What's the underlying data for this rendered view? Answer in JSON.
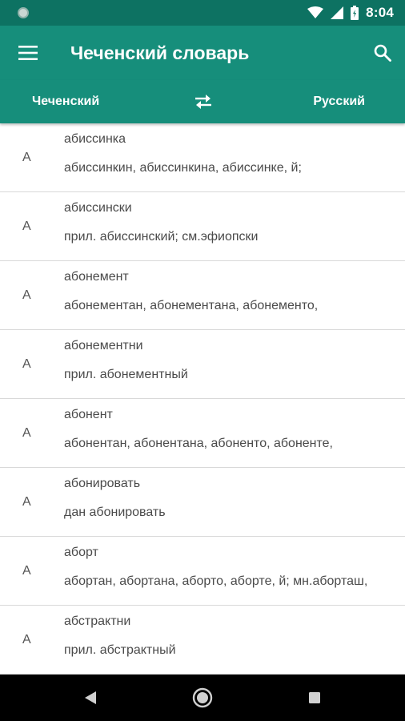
{
  "status_bar": {
    "time": "8:04",
    "icons": [
      "notification-dot-icon",
      "wifi-icon",
      "signal-icon",
      "battery-icon"
    ]
  },
  "app_bar": {
    "title": "Чеченский словарь",
    "menu_icon": "hamburger-menu-icon",
    "search_icon": "search-icon"
  },
  "language_bar": {
    "source_language": "Чеченский",
    "target_language": "Русский",
    "swap_icon": "swap-arrows-icon"
  },
  "entries": [
    {
      "letter": "А",
      "word": "абиссинка",
      "definition": "абиссинкин, абиссинкина, абиссинке, й;"
    },
    {
      "letter": "А",
      "word": "абиссински",
      "definition": "прил. абиссинский; см.эфиопски"
    },
    {
      "letter": "А",
      "word": "абонемент",
      "definition": "абонементан, абонементана, абонементо,"
    },
    {
      "letter": "А",
      "word": "абонементни",
      "definition": "прил. абонементный"
    },
    {
      "letter": "А",
      "word": "абонент",
      "definition": "абонентан, абонентана, абоненто, абоненте,"
    },
    {
      "letter": "А",
      "word": "абонировать",
      "definition": "дан абонировать"
    },
    {
      "letter": "А",
      "word": "аборт",
      "definition": "абортан, абортана, аборто, аборте, й; мн.аборташ,"
    },
    {
      "letter": "А",
      "word": "абстрактни",
      "definition": "прил. абстрактный"
    }
  ],
  "nav_bar": {
    "back_icon": "back-triangle-icon",
    "home_icon": "home-circle-icon",
    "recents_icon": "recents-square-icon"
  },
  "colors": {
    "status_bar": "#0d7262",
    "app_bar": "#168e7b",
    "text_primary": "#4a4a4a",
    "divider": "#d9d9d9"
  }
}
